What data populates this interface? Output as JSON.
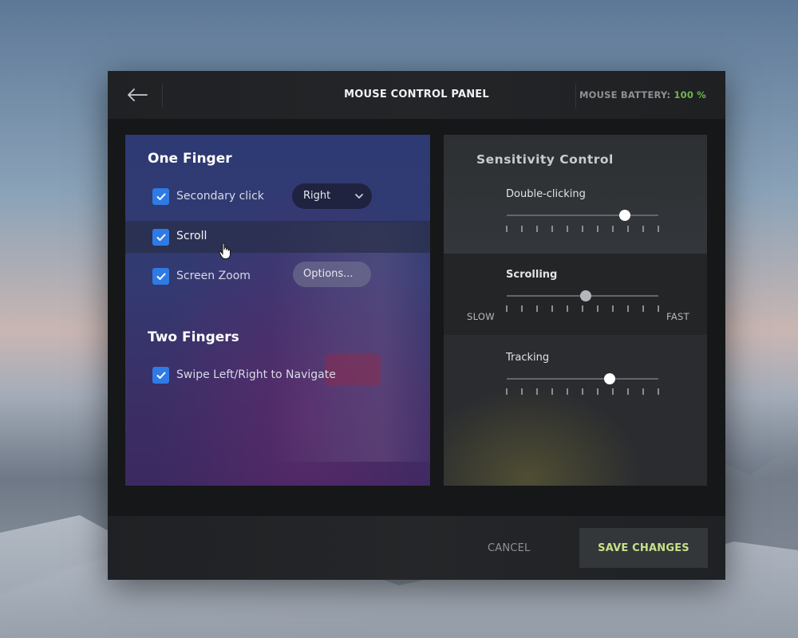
{
  "header": {
    "title": "MOUSE CONTROL PANEL",
    "battery_label": "MOUSE BATTERY:",
    "battery_value": "100 %"
  },
  "left": {
    "one_finger_title": "One Finger",
    "items": [
      {
        "label": "Secondary click",
        "checked": true,
        "select_value": "Right"
      },
      {
        "label": "Scroll",
        "checked": true
      },
      {
        "label": "Screen Zoom",
        "checked": true,
        "button_label": "Options..."
      }
    ],
    "two_fingers_title": "Two Fingers",
    "two_items": [
      {
        "label": "Swipe Left/Right to Navigate",
        "checked": true
      }
    ]
  },
  "sensitivity": {
    "title": "Sensitivity Control",
    "sliders": [
      {
        "label": "Double-clicking",
        "value": 0.78
      },
      {
        "label": "Scrolling",
        "value": 0.52
      },
      {
        "label": "Tracking",
        "value": 0.68
      }
    ],
    "slow_label": "SLOW",
    "fast_label": "FAST"
  },
  "footer": {
    "cancel_label": "CANCEL",
    "save_label": "SAVE CHANGES"
  },
  "colors": {
    "accent_checkbox": "#2f7be6",
    "battery_green": "#6fb84f",
    "save_text": "#c6e08a"
  }
}
